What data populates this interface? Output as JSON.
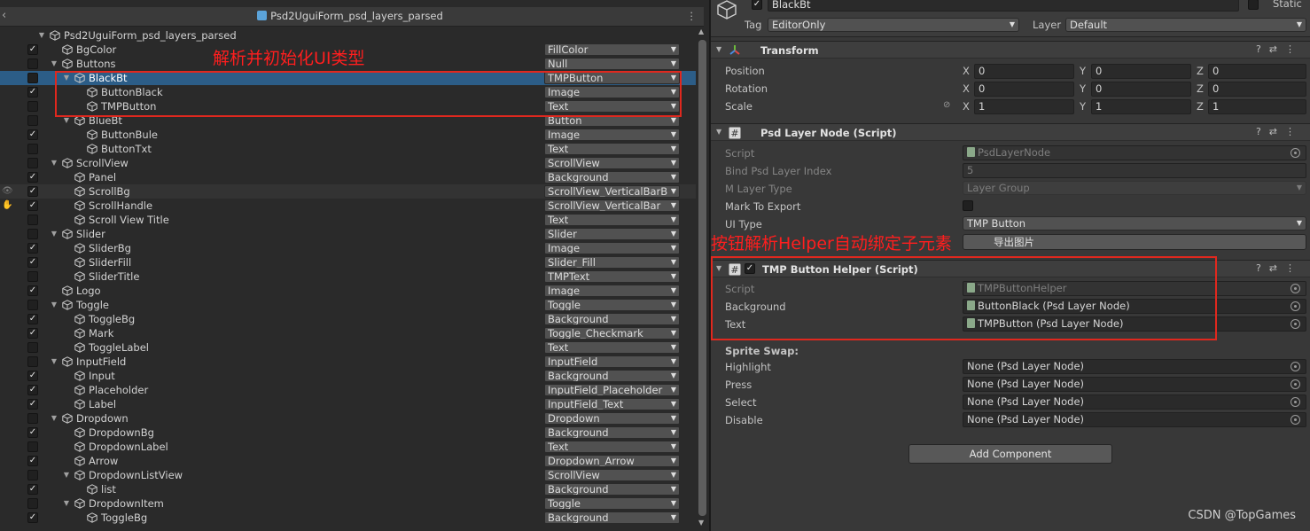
{
  "hierarchy": {
    "title": "Psd2UguiForm_psd_layers_parsed",
    "root": "Psd2UguiForm_psd_layers_parsed",
    "rows": [
      {
        "name": "BgColor",
        "depth": 1,
        "checked": true,
        "exp": "",
        "type": "FillColor"
      },
      {
        "name": "Buttons",
        "depth": 1,
        "checked": false,
        "exp": "open",
        "type": "Null"
      },
      {
        "name": "BlackBt",
        "depth": 2,
        "checked": false,
        "exp": "open",
        "type": "TMPButton",
        "sel": true
      },
      {
        "name": "ButtonBlack",
        "depth": 3,
        "checked": true,
        "exp": "",
        "type": "Image"
      },
      {
        "name": "TMPButton",
        "depth": 3,
        "checked": false,
        "exp": "",
        "type": "Text"
      },
      {
        "name": "BlueBt",
        "depth": 2,
        "checked": false,
        "exp": "open",
        "type": "Button"
      },
      {
        "name": "ButtonBule",
        "depth": 3,
        "checked": true,
        "exp": "",
        "type": "Image"
      },
      {
        "name": "ButtonTxt",
        "depth": 3,
        "checked": false,
        "exp": "",
        "type": "Text"
      },
      {
        "name": "ScrollView",
        "depth": 1,
        "checked": false,
        "exp": "open",
        "type": "ScrollView"
      },
      {
        "name": "Panel",
        "depth": 2,
        "checked": true,
        "exp": "",
        "type": "Background"
      },
      {
        "name": "ScrollBg",
        "depth": 2,
        "checked": true,
        "exp": "",
        "type": "ScrollView_VerticalBarB",
        "hov": true
      },
      {
        "name": "ScrollHandle",
        "depth": 2,
        "checked": true,
        "exp": "",
        "type": "ScrollView_VerticalBar"
      },
      {
        "name": "Scroll View Title",
        "depth": 2,
        "checked": false,
        "exp": "",
        "type": "Text"
      },
      {
        "name": "Slider",
        "depth": 1,
        "checked": false,
        "exp": "open",
        "type": "Slider"
      },
      {
        "name": "SliderBg",
        "depth": 2,
        "checked": true,
        "exp": "",
        "type": "Image"
      },
      {
        "name": "SliderFill",
        "depth": 2,
        "checked": true,
        "exp": "",
        "type": "Slider_Fill"
      },
      {
        "name": "SliderTitle",
        "depth": 2,
        "checked": false,
        "exp": "",
        "type": "TMPText"
      },
      {
        "name": "Logo",
        "depth": 1,
        "checked": true,
        "exp": "",
        "type": "Image"
      },
      {
        "name": "Toggle",
        "depth": 1,
        "checked": false,
        "exp": "open",
        "type": "Toggle"
      },
      {
        "name": "ToggleBg",
        "depth": 2,
        "checked": true,
        "exp": "",
        "type": "Background"
      },
      {
        "name": "Mark",
        "depth": 2,
        "checked": true,
        "exp": "",
        "type": "Toggle_Checkmark"
      },
      {
        "name": "ToggleLabel",
        "depth": 2,
        "checked": false,
        "exp": "",
        "type": "Text"
      },
      {
        "name": "InputField",
        "depth": 1,
        "checked": false,
        "exp": "open",
        "type": "InputField"
      },
      {
        "name": "Input",
        "depth": 2,
        "checked": true,
        "exp": "",
        "type": "Background"
      },
      {
        "name": "Placeholder",
        "depth": 2,
        "checked": true,
        "exp": "",
        "type": "InputField_Placeholder"
      },
      {
        "name": "Label",
        "depth": 2,
        "checked": true,
        "exp": "",
        "type": "InputField_Text"
      },
      {
        "name": "Dropdown",
        "depth": 1,
        "checked": false,
        "exp": "open",
        "type": "Dropdown"
      },
      {
        "name": "DropdownBg",
        "depth": 2,
        "checked": true,
        "exp": "",
        "type": "Background"
      },
      {
        "name": "DropdownLabel",
        "depth": 2,
        "checked": false,
        "exp": "",
        "type": "Text"
      },
      {
        "name": "Arrow",
        "depth": 2,
        "checked": true,
        "exp": "",
        "type": "Dropdown_Arrow"
      },
      {
        "name": "DropdownListView",
        "depth": 2,
        "checked": false,
        "exp": "open",
        "type": "ScrollView"
      },
      {
        "name": "list",
        "depth": 3,
        "checked": true,
        "exp": "",
        "type": "Background"
      },
      {
        "name": "DropdownItem",
        "depth": 2,
        "checked": false,
        "exp": "open",
        "type": "Toggle"
      },
      {
        "name": "ToggleBg",
        "depth": 3,
        "checked": true,
        "exp": "",
        "type": "Background"
      }
    ]
  },
  "inspector": {
    "object_name": "BlackBt",
    "static_label": "Static",
    "tag_label": "Tag",
    "tag_value": "EditorOnly",
    "layer_label": "Layer",
    "layer_value": "Default",
    "transform": {
      "title": "Transform",
      "rows": [
        {
          "label": "Position",
          "x": "0",
          "y": "0",
          "z": "0"
        },
        {
          "label": "Rotation",
          "x": "0",
          "y": "0",
          "z": "0"
        },
        {
          "label": "Scale",
          "x": "1",
          "y": "1",
          "z": "1"
        }
      ]
    },
    "psd_node": {
      "title": "Psd Layer Node (Script)",
      "script_label": "Script",
      "script_value": "PsdLayerNode",
      "bind_label": "Bind Psd Layer Index",
      "bind_value": "5",
      "mlayer_label": "M Layer Type",
      "mlayer_value": "Layer Group",
      "mark_label": "Mark To Export",
      "uitype_label": "UI Type",
      "uitype_value": "TMP Button",
      "export_button": "导出图片"
    },
    "helper": {
      "title": "TMP Button Helper (Script)",
      "script_label": "Script",
      "script_value": "TMPButtonHelper",
      "bg_label": "Background",
      "bg_value": "ButtonBlack (Psd Layer Node)",
      "text_label": "Text",
      "text_value": "TMPButton (Psd Layer Node)",
      "sprite_swap": "Sprite Swap:",
      "swaps": [
        {
          "label": "Highlight",
          "value": "None (Psd Layer Node)"
        },
        {
          "label": "Press",
          "value": "None (Psd Layer Node)"
        },
        {
          "label": "Select",
          "value": "None (Psd Layer Node)"
        },
        {
          "label": "Disable",
          "value": "None (Psd Layer Node)"
        }
      ]
    },
    "add_component": "Add Component"
  },
  "annotations": {
    "left": "解析并初始化UI类型",
    "right": "按钮解析Helper自动绑定子元素",
    "color": "#e0281e"
  },
  "watermark": "CSDN @TopGames"
}
